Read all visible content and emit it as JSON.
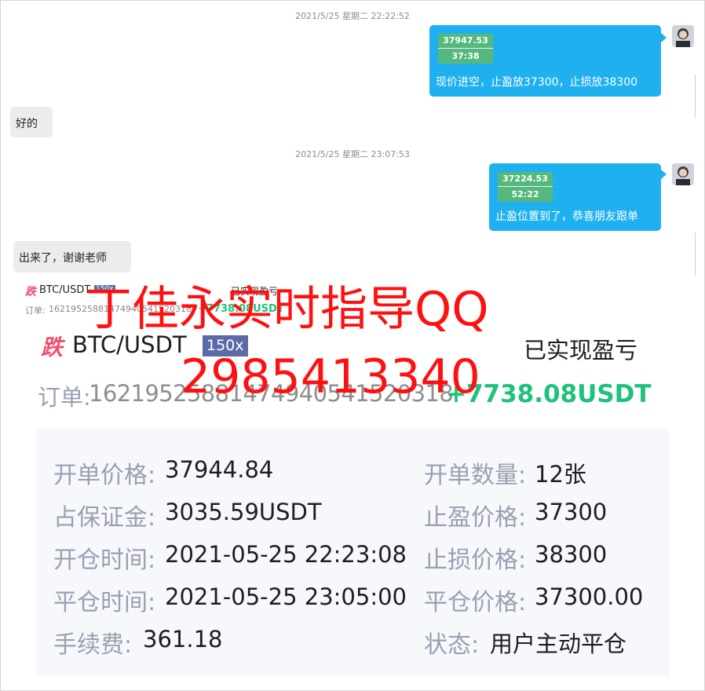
{
  "chat": {
    "timestamp1": "2021/5/25 星期二 22:22:52",
    "msg1": {
      "mini_price": "37947.53",
      "mini_time": "37:38",
      "text": "现价进空，止盈放37300，止损放38300"
    },
    "reply1": "好的",
    "timestamp2": "2021/5/25 星期二 23:07:53",
    "msg2": {
      "mini_price": "37224.53",
      "mini_time": "52:22",
      "text": "止盈位置到了，恭喜朋友跟单"
    },
    "reply2": "出来了，谢谢老师"
  },
  "order": {
    "direction": "跌",
    "pair": "BTC/USDT",
    "leverage": "150x",
    "realized_label": "已实现盈亏",
    "order_label": "订单:",
    "order_id": "16219525881474940541520318",
    "pnl": "+7738.08USDT",
    "fields_left": [
      {
        "label": "开单价格:",
        "value": "37944.84"
      },
      {
        "label": "占保证金:",
        "value": "3035.59USDT"
      },
      {
        "label": "开仓时间:",
        "value": "2021-05-25 22:23:08"
      },
      {
        "label": "平仓时间:",
        "value": "2021-05-25 23:05:00"
      },
      {
        "label": "手续费:",
        "value": "361.18"
      }
    ],
    "fields_right": [
      {
        "label": "开单数量:",
        "value": "12张"
      },
      {
        "label": "止盈价格:",
        "value": "37300"
      },
      {
        "label": "止损价格:",
        "value": "38300"
      },
      {
        "label": "平仓价格:",
        "value": "37300.00"
      },
      {
        "label": "状态:",
        "value": "用户主动平仓"
      }
    ],
    "small_order_prefix": "订单:",
    "small_order_id": "16219525881474940541520318",
    "small_pnl": "+7738.08USDT"
  },
  "watermark": {
    "line1": "丁佳永实时指导QQ",
    "line2": "2985413340"
  },
  "colors": {
    "bubble_blue": "#1fb0f0",
    "pnl_green": "#1ec27a",
    "watermark_red": "#ff1010",
    "leverage_bg": "#5d6aa8",
    "direction_pink": "#f0506e"
  }
}
